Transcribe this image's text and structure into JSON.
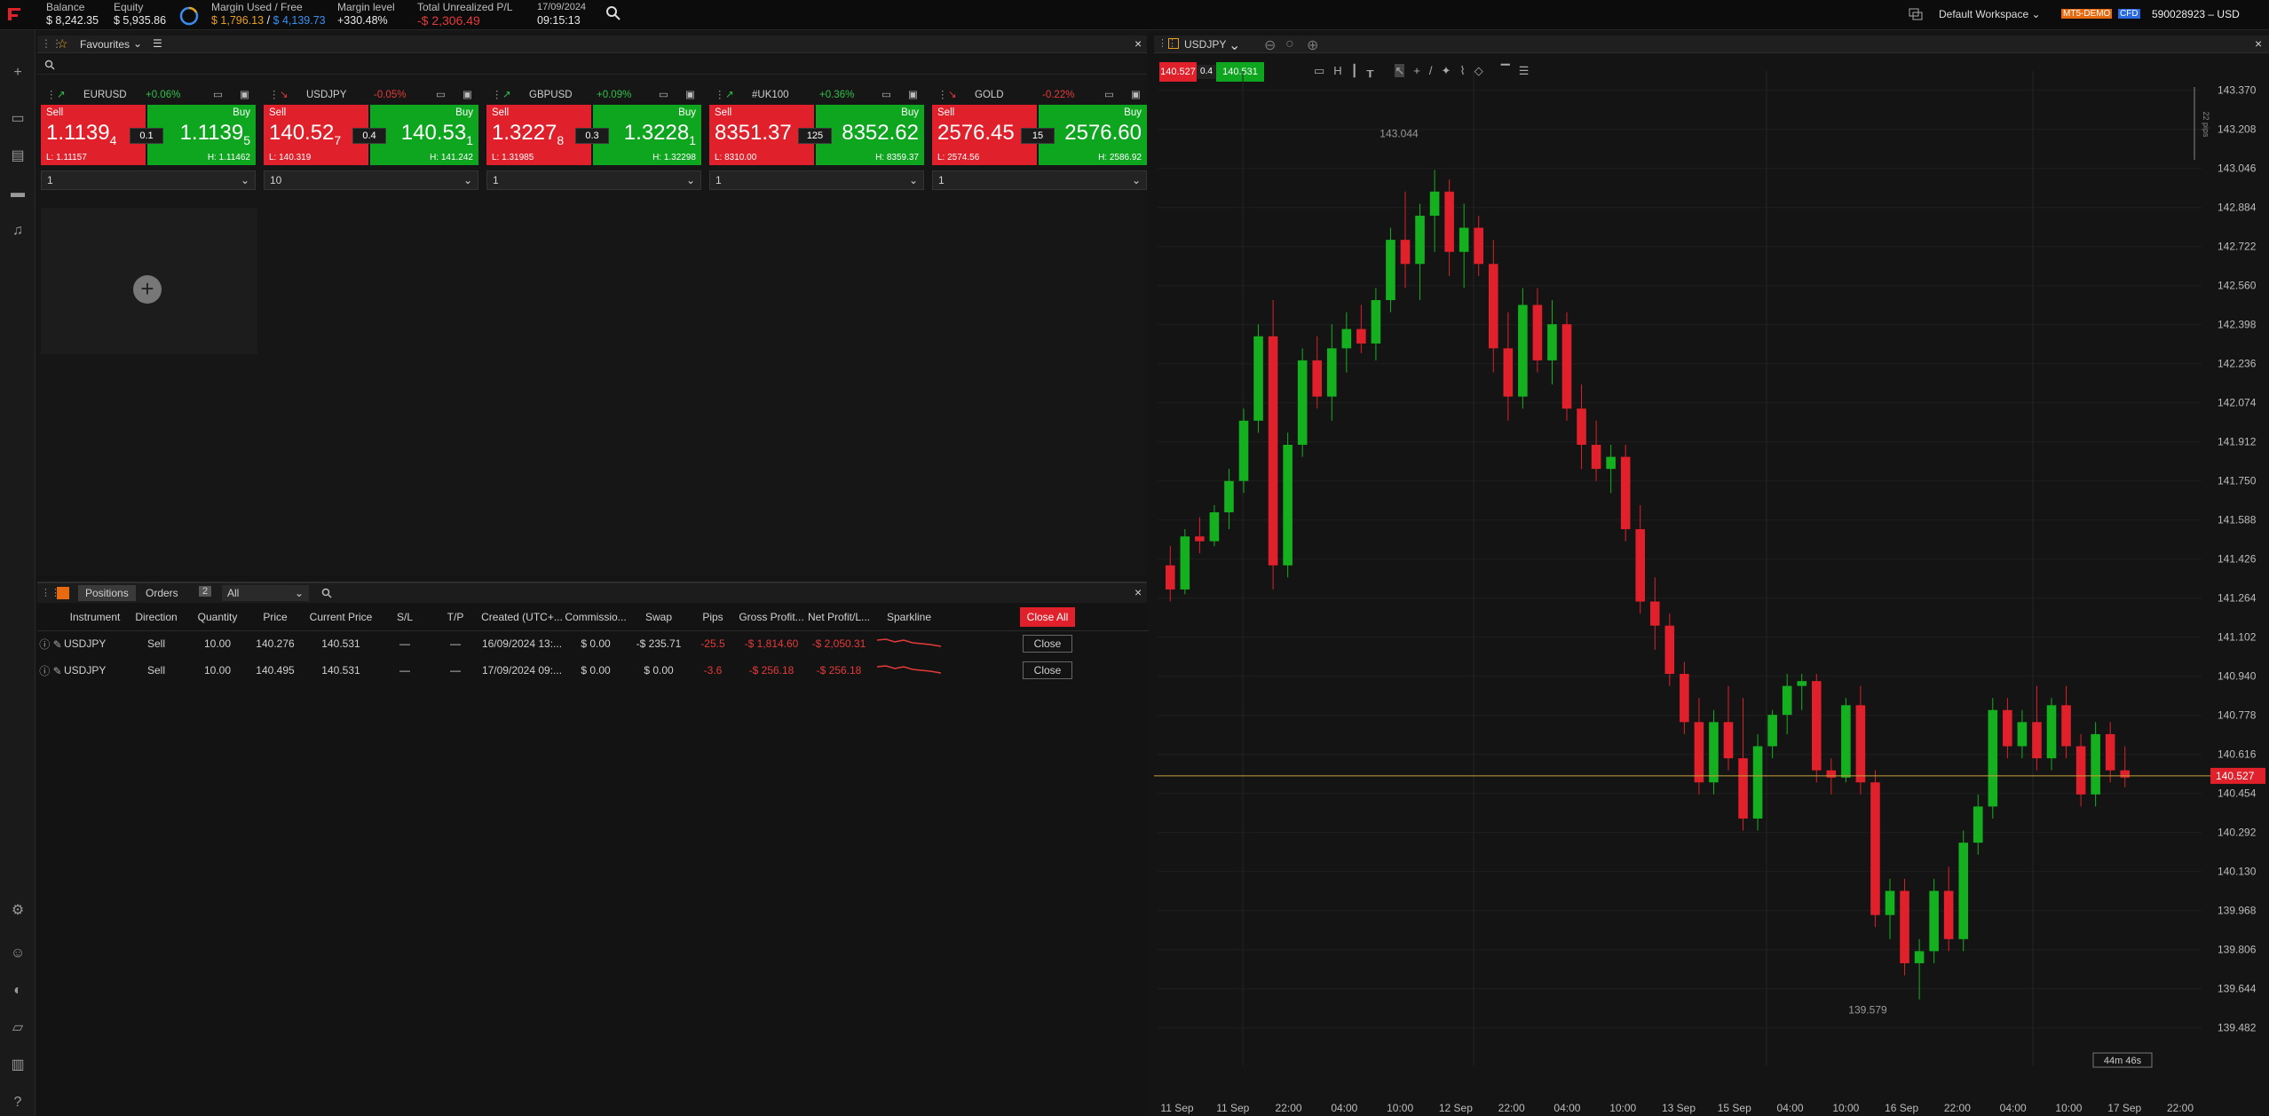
{
  "top": {
    "balance_label": "Balance",
    "balance": "$ 8,242.35",
    "equity_label": "Equity",
    "equity": "$ 5,935.86",
    "margin_label": "Margin Used / Free",
    "margin_used": "$ 1,796.13",
    "margin_free": "$ 4,139.73",
    "margin_level_label": "Margin level",
    "margin_level": "+330.48%",
    "upl_label": "Total Unrealized P/L",
    "upl": "-$ 2,306.49",
    "date": "17/09/2024",
    "time": "09:15:13",
    "workspace": "Default Workspace",
    "badge1": "MT5-DEMO",
    "badge2": "CFD",
    "account": "590028923 – USD"
  },
  "favourites": {
    "title": "Favourites",
    "cards": [
      {
        "symbol": "EURUSD",
        "change": "+0.06%",
        "sell_label": "Sell",
        "buy_label": "Buy",
        "sell_main": "1.1139",
        "sell_sup": "4",
        "buy_main": "1.1139",
        "buy_sup": "5",
        "spread": "0.1",
        "low": "L: 1.11157",
        "high": "H: 1.11462",
        "qty": "1"
      },
      {
        "symbol": "USDJPY",
        "change": "-0.05%",
        "sell_label": "Sell",
        "buy_label": "Buy",
        "sell_main": "140.52",
        "sell_sup": "7",
        "buy_main": "140.53",
        "buy_sup": "1",
        "spread": "0.4",
        "low": "L: 140.319",
        "high": "H: 141.242",
        "qty": "10"
      },
      {
        "symbol": "GBPUSD",
        "change": "+0.09%",
        "sell_label": "Sell",
        "buy_label": "Buy",
        "sell_main": "1.3227",
        "sell_sup": "8",
        "buy_main": "1.3228",
        "buy_sup": "1",
        "spread": "0.3",
        "low": "L: 1.31985",
        "high": "H: 1.32298",
        "qty": "1"
      },
      {
        "symbol": "#UK100",
        "change": "+0.36%",
        "sell_label": "Sell",
        "buy_label": "Buy",
        "sell_main": "8351.37",
        "sell_sup": "",
        "buy_main": "8352.62",
        "buy_sup": "",
        "spread": "125",
        "low": "L: 8310.00",
        "high": "H: 8359.37",
        "qty": "1"
      },
      {
        "symbol": "GOLD",
        "change": "-0.22%",
        "sell_label": "Sell",
        "buy_label": "Buy",
        "sell_main": "2576.45",
        "sell_sup": "",
        "buy_main": "2576.60",
        "buy_sup": "",
        "spread": "15",
        "low": "L: 2574.56",
        "high": "H: 2586.92",
        "qty": "1"
      }
    ]
  },
  "positions": {
    "tab_positions": "Positions",
    "tab_orders": "Orders",
    "count": "2",
    "filter": "All",
    "close_all": "Close All",
    "close_label": "Close",
    "columns": [
      "Instrument",
      "Direction",
      "Quantity",
      "Price",
      "Current Price",
      "S/L",
      "T/P",
      "Created (UTC+...",
      "Commissio...",
      "Swap",
      "Pips",
      "Gross Profit...",
      "Net Profit/L...",
      "Sparkline"
    ],
    "rows": [
      {
        "instrument": "USDJPY",
        "direction": "Sell",
        "quantity": "10.00",
        "price": "140.276",
        "current": "140.531",
        "sl": "—",
        "tp": "—",
        "created": "16/09/2024 13:...",
        "commission": "$ 0.00",
        "swap": "-$ 235.71",
        "pips": "-25.5",
        "gross": "-$ 1,814.60",
        "net": "-$ 2,050.31"
      },
      {
        "instrument": "USDJPY",
        "direction": "Sell",
        "quantity": "10.00",
        "price": "140.495",
        "current": "140.531",
        "sl": "—",
        "tp": "—",
        "created": "17/09/2024 09:...",
        "commission": "$ 0.00",
        "swap": "$ 0.00",
        "pips": "-3.6",
        "gross": "-$ 256.18",
        "net": "-$ 256.18"
      }
    ]
  },
  "chart": {
    "symbol": "USDJPY",
    "sell": "140.527",
    "buy": "140.531",
    "spread": "0.4",
    "high_label": "143.044",
    "low_label": "139.579",
    "countdown": "44m 46s",
    "current_price": "140.527",
    "pips_label": "22 pips",
    "y_ticks": [
      "143.370",
      "143.208",
      "143.046",
      "142.884",
      "142.722",
      "142.560",
      "142.398",
      "142.236",
      "142.074",
      "141.912",
      "141.750",
      "141.588",
      "141.426",
      "141.264",
      "141.102",
      "140.940",
      "140.778",
      "140.616",
      "140.454",
      "140.292",
      "140.130",
      "139.968",
      "139.806",
      "139.644",
      "139.482"
    ],
    "x_ticks": [
      "11 Sep",
      "11 Sep",
      "22:00",
      "04:00",
      "10:00",
      "12 Sep",
      "22:00",
      "04:00",
      "10:00",
      "13 Sep",
      "15 Sep",
      "04:00",
      "10:00",
      "16 Sep",
      "22:00",
      "04:00",
      "10:00",
      "17 Sep",
      "22:00"
    ]
  },
  "chart_data": {
    "type": "candlestick",
    "title": "",
    "ylim": [
      139.4,
      143.45
    ],
    "candles": [
      [
        141.4,
        141.48,
        141.25,
        141.3
      ],
      [
        141.3,
        141.55,
        141.28,
        141.52
      ],
      [
        141.52,
        141.6,
        141.45,
        141.5
      ],
      [
        141.5,
        141.65,
        141.48,
        141.62
      ],
      [
        141.62,
        141.8,
        141.55,
        141.75
      ],
      [
        141.75,
        142.05,
        141.7,
        142.0
      ],
      [
        142.0,
        142.4,
        141.95,
        142.35
      ],
      [
        142.35,
        142.5,
        141.3,
        141.4
      ],
      [
        141.4,
        141.95,
        141.35,
        141.9
      ],
      [
        141.9,
        142.3,
        141.85,
        142.25
      ],
      [
        142.25,
        142.35,
        142.05,
        142.1
      ],
      [
        142.1,
        142.4,
        142.0,
        142.3
      ],
      [
        142.3,
        142.45,
        142.2,
        142.38
      ],
      [
        142.38,
        142.48,
        142.28,
        142.32
      ],
      [
        142.32,
        142.55,
        142.25,
        142.5
      ],
      [
        142.5,
        142.8,
        142.45,
        142.75
      ],
      [
        142.75,
        142.95,
        142.55,
        142.65
      ],
      [
        142.65,
        142.9,
        142.5,
        142.85
      ],
      [
        142.85,
        143.04,
        142.7,
        142.95
      ],
      [
        142.95,
        143.0,
        142.6,
        142.7
      ],
      [
        142.7,
        142.9,
        142.55,
        142.8
      ],
      [
        142.8,
        142.85,
        142.6,
        142.65
      ],
      [
        142.65,
        142.75,
        142.2,
        142.3
      ],
      [
        142.3,
        142.45,
        142.0,
        142.1
      ],
      [
        142.1,
        142.55,
        142.05,
        142.48
      ],
      [
        142.48,
        142.55,
        142.2,
        142.25
      ],
      [
        142.25,
        142.5,
        142.15,
        142.4
      ],
      [
        142.4,
        142.45,
        142.0,
        142.05
      ],
      [
        142.05,
        142.15,
        141.8,
        141.9
      ],
      [
        141.9,
        142.0,
        141.75,
        141.8
      ],
      [
        141.8,
        141.9,
        141.7,
        141.85
      ],
      [
        141.85,
        141.9,
        141.5,
        141.55
      ],
      [
        141.55,
        141.65,
        141.2,
        141.25
      ],
      [
        141.25,
        141.35,
        141.05,
        141.15
      ],
      [
        141.15,
        141.2,
        140.9,
        140.95
      ],
      [
        140.95,
        141.0,
        140.7,
        140.75
      ],
      [
        140.75,
        140.85,
        140.45,
        140.5
      ],
      [
        140.5,
        140.8,
        140.45,
        140.75
      ],
      [
        140.75,
        140.9,
        140.55,
        140.6
      ],
      [
        140.6,
        140.85,
        140.3,
        140.35
      ],
      [
        140.35,
        140.7,
        140.3,
        140.65
      ],
      [
        140.65,
        140.8,
        140.6,
        140.78
      ],
      [
        140.78,
        140.95,
        140.7,
        140.9
      ],
      [
        140.9,
        140.95,
        140.8,
        140.92
      ],
      [
        140.92,
        140.95,
        140.5,
        140.55
      ],
      [
        140.55,
        140.6,
        140.45,
        140.52
      ],
      [
        140.52,
        140.85,
        140.5,
        140.82
      ],
      [
        140.82,
        140.9,
        140.45,
        140.5
      ],
      [
        140.5,
        140.55,
        139.9,
        139.95
      ],
      [
        139.95,
        140.1,
        139.85,
        140.05
      ],
      [
        140.05,
        140.1,
        139.7,
        139.75
      ],
      [
        139.75,
        139.85,
        139.6,
        139.8
      ],
      [
        139.8,
        140.1,
        139.75,
        140.05
      ],
      [
        140.05,
        140.15,
        139.8,
        139.85
      ],
      [
        139.85,
        140.3,
        139.8,
        140.25
      ],
      [
        140.25,
        140.45,
        140.2,
        140.4
      ],
      [
        140.4,
        140.85,
        140.35,
        140.8
      ],
      [
        140.8,
        140.85,
        140.6,
        140.65
      ],
      [
        140.65,
        140.8,
        140.6,
        140.75
      ],
      [
        140.75,
        140.9,
        140.55,
        140.6
      ],
      [
        140.6,
        140.85,
        140.55,
        140.82
      ],
      [
        140.82,
        140.9,
        140.6,
        140.65
      ],
      [
        140.65,
        140.7,
        140.4,
        140.45
      ],
      [
        140.45,
        140.75,
        140.4,
        140.7
      ],
      [
        140.7,
        140.75,
        140.5,
        140.55
      ],
      [
        140.55,
        140.65,
        140.48,
        140.52
      ]
    ]
  }
}
